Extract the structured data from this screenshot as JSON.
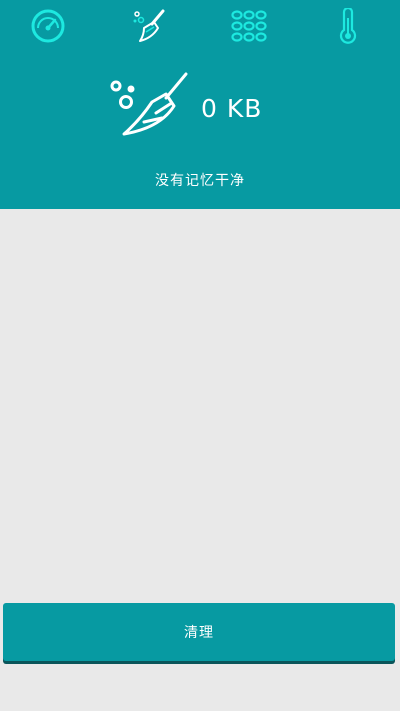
{
  "tabs": [
    {
      "icon": "speedometer-icon",
      "active": false
    },
    {
      "icon": "broom-icon",
      "active": true
    },
    {
      "icon": "apps-grid-icon",
      "active": false
    },
    {
      "icon": "thermometer-icon",
      "active": false
    }
  ],
  "cleaner": {
    "icon": "broom-icon",
    "size_value": "0 KB",
    "status_text": "没有记忆干净"
  },
  "actions": {
    "clean_label": "清理"
  },
  "colors": {
    "primary": "#079aa2",
    "icon_cyan": "#1de9e0",
    "background": "#e9e9e9",
    "button_shadow": "#0a555a"
  }
}
